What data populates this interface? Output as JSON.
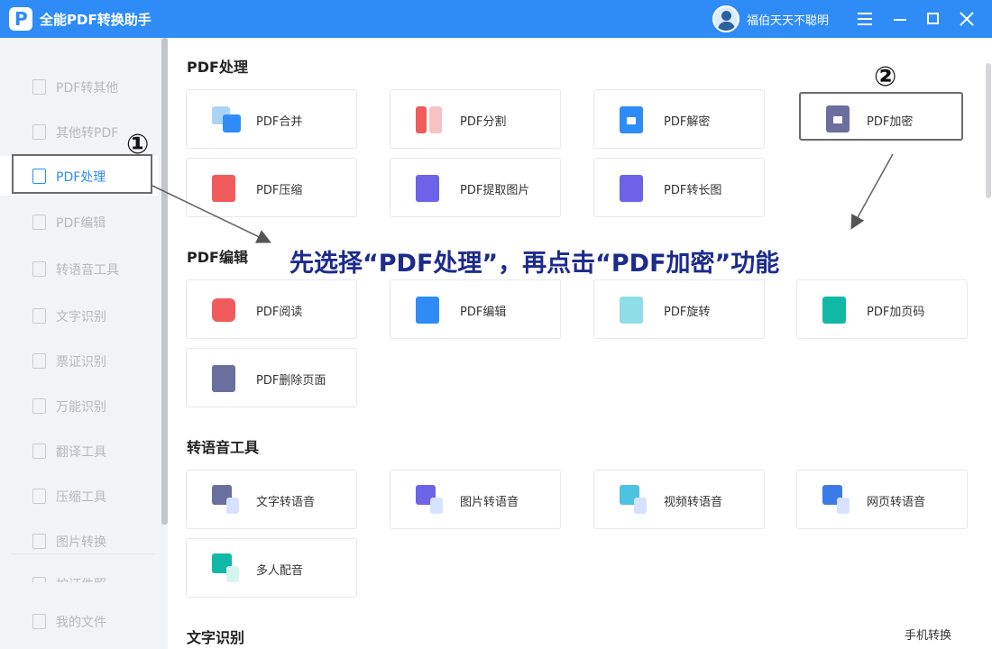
{
  "app": {
    "title": "全能PDF转换助手",
    "logo_letter": "P"
  },
  "user": {
    "name": "福伯天天不聪明"
  },
  "sidebar": {
    "items": [
      {
        "label": "PDF转其他",
        "icon": "pdf-file-icon"
      },
      {
        "label": "其他转PDF",
        "icon": "pdf-file-icon"
      },
      {
        "label": "PDF处理",
        "icon": "pdf-process-icon",
        "active": true
      },
      {
        "label": "PDF编辑",
        "icon": "pdf-edit-icon"
      },
      {
        "label": "转语音工具",
        "icon": "audio-icon"
      },
      {
        "label": "文字识别",
        "icon": "ocr-icon"
      },
      {
        "label": "票证识别",
        "icon": "ticket-icon"
      },
      {
        "label": "万能识别",
        "icon": "scan-icon"
      },
      {
        "label": "翻译工具",
        "icon": "translate-icon"
      },
      {
        "label": "压缩工具",
        "icon": "compress-icon"
      },
      {
        "label": "图片转换",
        "icon": "image-icon"
      },
      {
        "label": "护证件照",
        "icon": "id-photo-icon"
      }
    ],
    "my_files": "我的文件"
  },
  "sections": {
    "pdf_process": {
      "title": "PDF处理",
      "cards": [
        "PDF合并",
        "PDF分割",
        "PDF解密",
        "PDF加密",
        "PDF压缩",
        "PDF提取图片",
        "PDF转长图"
      ]
    },
    "pdf_edit": {
      "title": "PDF编辑",
      "cards": [
        "PDF阅读",
        "PDF编辑",
        "PDF旋转",
        "PDF加页码",
        "PDF删除页面"
      ]
    },
    "tts": {
      "title": "转语音工具",
      "cards": [
        "文字转语音",
        "图片转语音",
        "视频转语音",
        "网页转语音",
        "多人配音"
      ]
    },
    "ocr": {
      "title": "文字识别",
      "phone_convert": "手机转换"
    }
  },
  "annotation": {
    "instruction": "先选择“PDF处理”，再点击“PDF加密”功能",
    "marker1": "①",
    "marker2": "②"
  },
  "colors": {
    "accent": "#2f8cf7",
    "annotation_text": "#1c2b8c",
    "sidebar_bg": "#f2f3f5"
  }
}
